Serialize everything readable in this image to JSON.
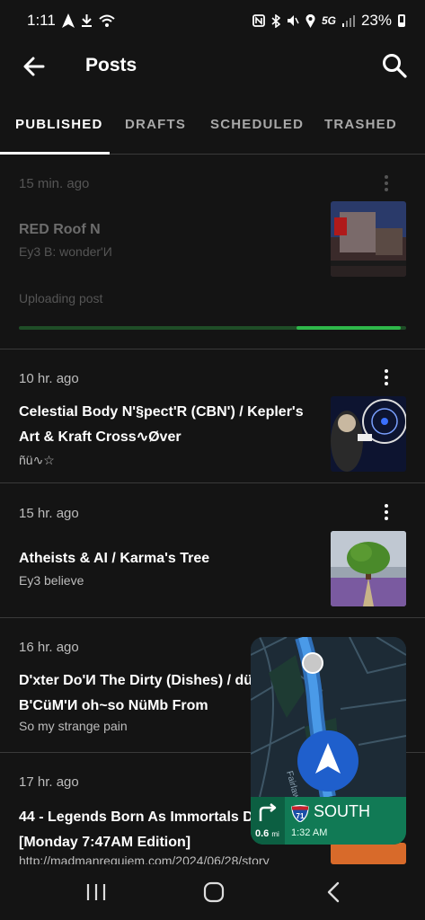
{
  "status": {
    "time": "1:11",
    "network": "5G",
    "battery": "23%"
  },
  "header": {
    "title": "Posts"
  },
  "tabs": [
    {
      "label": "PUBLISHED",
      "active": true
    },
    {
      "label": "DRAFTS",
      "active": false
    },
    {
      "label": "SCHEDULED",
      "active": false
    },
    {
      "label": "TRASHED",
      "active": false
    }
  ],
  "posts": [
    {
      "time": "15 min. ago",
      "title": "RED Roof N",
      "subtitle": "Ey3 B: wonder'И",
      "upload_label": "Uploading post",
      "upload_progress": 0.27
    },
    {
      "time": "10 hr. ago",
      "title": "Celestial Body N'§pect'R (CBN') / Kepler's Art & Kraft Cross∿Øver",
      "subtitle": "ñü∿☆"
    },
    {
      "time": "15 hr. ago",
      "title": "Atheists & AI / Karma's Tree",
      "subtitle": "Ey3 believe"
    },
    {
      "time": "16 hr. ago",
      "title": "D'xter Do'И The Dirty (Dishes) / dü Thumb B'CüM'И oh~so NüMb From",
      "subtitle": "So my strange pain"
    },
    {
      "time": "17 hr. ago",
      "title": "44 - Legends Born As Immortals D [Monday 7:47AM Edition]",
      "subtitle": "http://madmanrequiem.com/2024/06/28/story"
    }
  ],
  "map_pip": {
    "street": "Fairlawn Dr",
    "route_shield": "71",
    "direction": "SOUTH",
    "distance": "0.6",
    "distance_unit": "mi",
    "eta": "1:32 AM"
  },
  "colors": {
    "background": "#141414",
    "accent_green": "#2fb84a",
    "nav_banner": "#117a55"
  }
}
